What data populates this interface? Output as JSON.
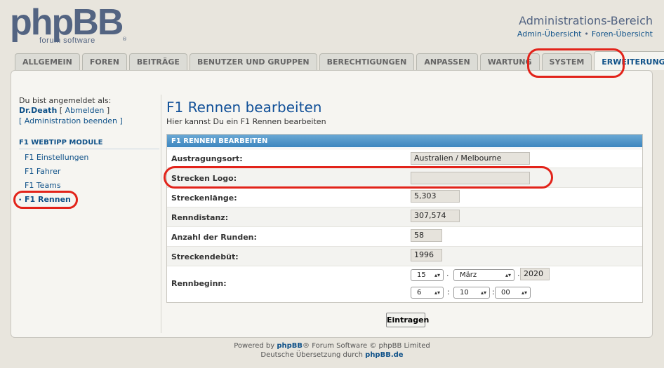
{
  "header": {
    "logo_main": "phpBB",
    "logo_sub": "forum software",
    "logo_reg": "®",
    "title": "Administrations-Bereich",
    "link_overview": "Admin-Übersicht",
    "link_sep": "•",
    "link_forums": "Foren-Übersicht"
  },
  "tabs": [
    {
      "label": "ALLGEMEIN"
    },
    {
      "label": "FOREN"
    },
    {
      "label": "BEITRÄGE"
    },
    {
      "label": "BENUTZER UND GRUPPEN"
    },
    {
      "label": "BERECHTIGUNGEN"
    },
    {
      "label": "ANPASSEN"
    },
    {
      "label": "WARTUNG"
    },
    {
      "label": "SYSTEM"
    },
    {
      "label": "ERWEITERUNGEN",
      "active": true
    }
  ],
  "sidebar": {
    "logged_in_label": "Du bist angemeldet als:",
    "username": "Dr.Death",
    "logout_open": "[",
    "logout": "Abmelden",
    "logout_close": "]",
    "admin_end": "[ Administration beenden ]",
    "module_heading": "F1 WEBTIPP MODULE",
    "bullet": "•",
    "items": [
      {
        "label": "F1 Einstellungen"
      },
      {
        "label": "F1 Fahrer"
      },
      {
        "label": "F1 Teams"
      },
      {
        "label": "F1 Rennen",
        "active": true
      }
    ]
  },
  "main": {
    "title": "F1 Rennen bearbeiten",
    "description": "Hier kannst Du ein F1 Rennen bearbeiten",
    "form_heading": "F1 RENNEN BEARBEITEN",
    "fields": {
      "venue": {
        "label": "Austragungsort:",
        "value": "Australien / Melbourne"
      },
      "logo": {
        "label": "Strecken Logo:",
        "value": ""
      },
      "length": {
        "label": "Streckenlänge:",
        "value": "5,303"
      },
      "distance": {
        "label": "Renndistanz:",
        "value": "307,574"
      },
      "laps": {
        "label": "Anzahl der Runden:",
        "value": "58"
      },
      "debut": {
        "label": "Streckendebüt:",
        "value": "1996"
      },
      "start": {
        "label": "Rennbeginn:",
        "day": "15",
        "month": "März",
        "year": "2020",
        "hour": "6",
        "minute": "10",
        "second": "00",
        "date_sep": ".",
        "time_sep": ":"
      }
    },
    "submit_label": "Eintragen"
  },
  "footer": {
    "line1_prefix": "Powered by ",
    "line1_brand": "phpBB",
    "line1_suffix": "® Forum Software © phpBB Limited",
    "line2_prefix": "Deutsche Übersetzung durch ",
    "line2_brand": "phpBB.de"
  },
  "colors": {
    "accent": "#105289",
    "title": "#115098",
    "highlight": "#e2231a",
    "form_header": "#3d86bf"
  }
}
